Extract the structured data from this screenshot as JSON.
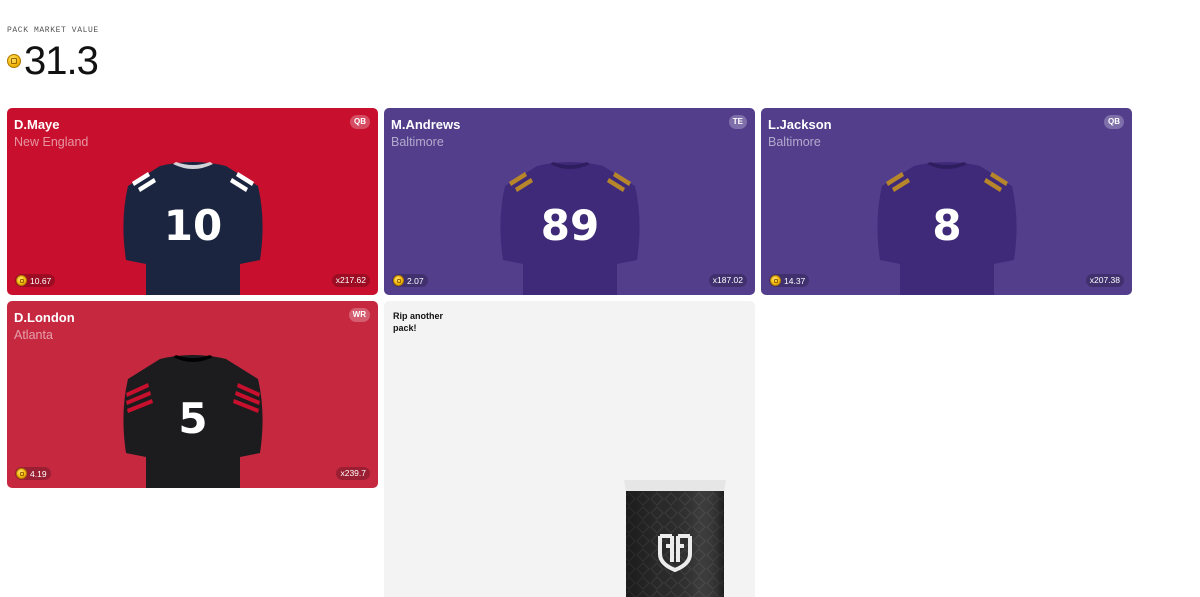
{
  "header": {
    "label": "PACK MARKET VALUE",
    "value": "31.3",
    "icon": "coin-icon"
  },
  "cards": [
    {
      "name": "D.Maye",
      "team": "New England",
      "position": "QB",
      "price": "10.67",
      "multiplier": "x217.62",
      "number": "10",
      "bg": "#c8102e",
      "jersey": "#1b2540",
      "sleeve": "#ffffff"
    },
    {
      "name": "M.Andrews",
      "team": "Baltimore",
      "position": "TE",
      "price": "2.07",
      "multiplier": "x187.02",
      "number": "89",
      "bg": "#533e8c",
      "jersey": "#3e2a78",
      "sleeve": "#b8862a"
    },
    {
      "name": "L.Jackson",
      "team": "Baltimore",
      "position": "QB",
      "price": "14.37",
      "multiplier": "x207.38",
      "number": "8",
      "bg": "#533e8c",
      "jersey": "#3e2a78",
      "sleeve": "#b8862a"
    },
    {
      "name": "D.London",
      "team": "Atlanta",
      "position": "WR",
      "price": "4.19",
      "multiplier": "x239.7",
      "number": "5",
      "bg": "#c62840",
      "jersey": "#1c1c1e",
      "sleeve": "#c8102e"
    }
  ],
  "rip": {
    "text": "Rip another pack!"
  }
}
